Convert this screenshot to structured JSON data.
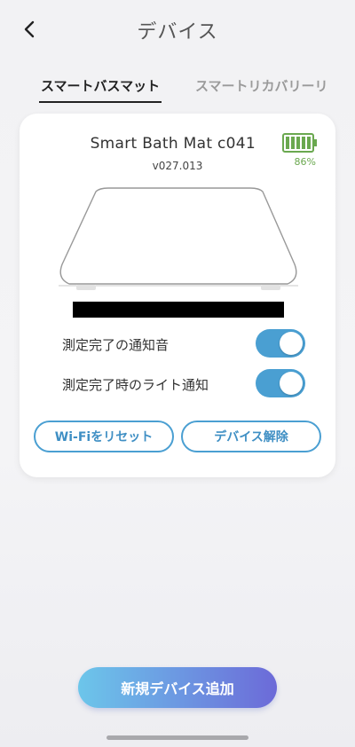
{
  "header": {
    "title": "デバイス",
    "back_icon": "chevron-left-icon"
  },
  "tabs": [
    {
      "label": "スマートバスマット",
      "active": true
    },
    {
      "label": "スマートリカバリーリ",
      "active": false
    }
  ],
  "device": {
    "name": "Smart Bath Mat c041",
    "firmware": "v027.013",
    "battery_percent": "86%",
    "battery_level": 0.86,
    "battery_color": "#6aa84f"
  },
  "settings": [
    {
      "label": "測定完了の通知音",
      "enabled": true
    },
    {
      "label": "測定完了時のライト通知",
      "enabled": true
    }
  ],
  "buttons": {
    "reset_wifi": "Wi-Fiをリセット",
    "unpair": "デバイス解除",
    "add_device": "新規デバイス追加"
  },
  "colors": {
    "accent": "#4a9fd2"
  }
}
